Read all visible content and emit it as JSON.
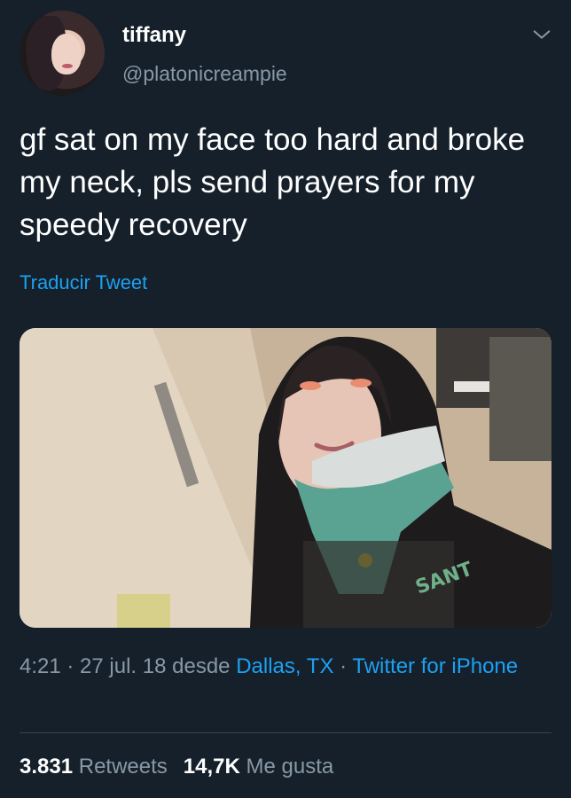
{
  "author": {
    "display_name": "tiffany",
    "handle": "@platonicreampie"
  },
  "tweet": {
    "text": "gf sat on my face too hard and broke my neck, pls send prayers for my speedy recovery",
    "translate_label": "Traducir Tweet",
    "image_description_icon": "photo"
  },
  "meta": {
    "time": "4:21",
    "separator1": " · ",
    "date": "27 jul. 18",
    "from_label": " desde ",
    "location": "Dallas, TX",
    "separator2": " · ",
    "source": "Twitter for iPhone"
  },
  "stats": {
    "retweets_count": "3.831",
    "retweets_label": "Retweets",
    "likes_count": "14,7K",
    "likes_label": "Me gusta"
  },
  "colors": {
    "background": "#15202b",
    "accent": "#1da1f2",
    "secondary_text": "#8899a6",
    "divider": "#38444d"
  },
  "icons": {
    "menu": "chevron-down-icon"
  }
}
